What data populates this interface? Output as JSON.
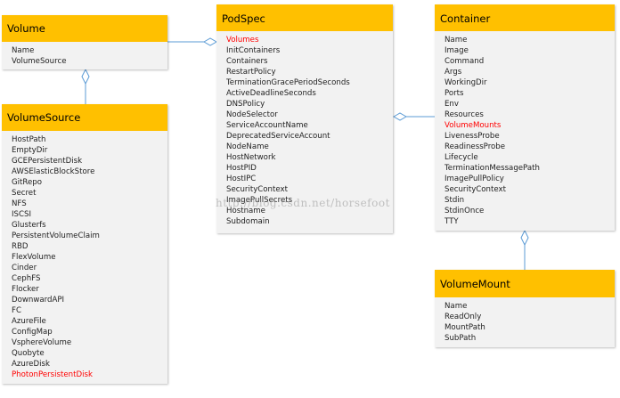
{
  "colors": {
    "header": "#ffc000",
    "body": "#f2f2f2",
    "highlight": "#ff0000",
    "connector": "#5b9bd5"
  },
  "boxes": {
    "volume": {
      "title": "Volume",
      "fields": [
        {
          "name": "Name"
        },
        {
          "name": "VolumeSource"
        }
      ]
    },
    "volume_source": {
      "title": "VolumeSource",
      "fields": [
        {
          "name": "HostPath"
        },
        {
          "name": "EmptyDir"
        },
        {
          "name": "GCEPersistentDisk"
        },
        {
          "name": "AWSElasticBlockStore"
        },
        {
          "name": "GitRepo"
        },
        {
          "name": "Secret"
        },
        {
          "name": "NFS"
        },
        {
          "name": "ISCSI"
        },
        {
          "name": "Glusterfs"
        },
        {
          "name": "PersistentVolumeClaim"
        },
        {
          "name": "RBD"
        },
        {
          "name": "FlexVolume"
        },
        {
          "name": "Cinder"
        },
        {
          "name": "CephFS"
        },
        {
          "name": "Flocker"
        },
        {
          "name": "DownwardAPI"
        },
        {
          "name": "FC"
        },
        {
          "name": "AzureFile"
        },
        {
          "name": "ConfigMap"
        },
        {
          "name": "VsphereVolume"
        },
        {
          "name": "Quobyte"
        },
        {
          "name": "AzureDisk"
        },
        {
          "name": "PhotonPersistentDisk",
          "highlight": true
        }
      ]
    },
    "pod_spec": {
      "title": "PodSpec",
      "fields": [
        {
          "name": "Volumes",
          "highlight": true
        },
        {
          "name": "InitContainers"
        },
        {
          "name": "Containers"
        },
        {
          "name": "RestartPolicy"
        },
        {
          "name": "TerminationGracePeriodSeconds"
        },
        {
          "name": "ActiveDeadlineSeconds"
        },
        {
          "name": "DNSPolicy"
        },
        {
          "name": "NodeSelector"
        },
        {
          "name": "ServiceAccountName"
        },
        {
          "name": "DeprecatedServiceAccount"
        },
        {
          "name": "NodeName"
        },
        {
          "name": "HostNetwork"
        },
        {
          "name": "HostPID"
        },
        {
          "name": "HostIPC"
        },
        {
          "name": "SecurityContext"
        },
        {
          "name": "ImagePullSecrets"
        },
        {
          "name": "Hostname"
        },
        {
          "name": "Subdomain"
        }
      ]
    },
    "container": {
      "title": "Container",
      "fields": [
        {
          "name": "Name"
        },
        {
          "name": "Image"
        },
        {
          "name": "Command"
        },
        {
          "name": "Args"
        },
        {
          "name": "WorkingDir"
        },
        {
          "name": "Ports"
        },
        {
          "name": "Env"
        },
        {
          "name": "Resources"
        },
        {
          "name": "VolumeMounts",
          "highlight": true
        },
        {
          "name": "LivenessProbe"
        },
        {
          "name": "ReadinessProbe"
        },
        {
          "name": "Lifecycle"
        },
        {
          "name": "TerminationMessagePath"
        },
        {
          "name": "ImagePullPolicy"
        },
        {
          "name": "SecurityContext"
        },
        {
          "name": "Stdin"
        },
        {
          "name": "StdinOnce"
        },
        {
          "name": "TTY"
        }
      ]
    },
    "volume_mount": {
      "title": "VolumeMount",
      "fields": [
        {
          "name": "Name"
        },
        {
          "name": "ReadOnly"
        },
        {
          "name": "MountPath"
        },
        {
          "name": "SubPath"
        }
      ]
    }
  },
  "connections": [
    {
      "from": "volume",
      "to": "pod_spec",
      "kind": "aggregation"
    },
    {
      "from": "volume_source",
      "to": "volume",
      "kind": "aggregation"
    },
    {
      "from": "container",
      "to": "pod_spec",
      "kind": "aggregation"
    },
    {
      "from": "volume_mount",
      "to": "container",
      "kind": "aggregation"
    }
  ],
  "watermark": "http://blog.csdn.net/horsefoot"
}
